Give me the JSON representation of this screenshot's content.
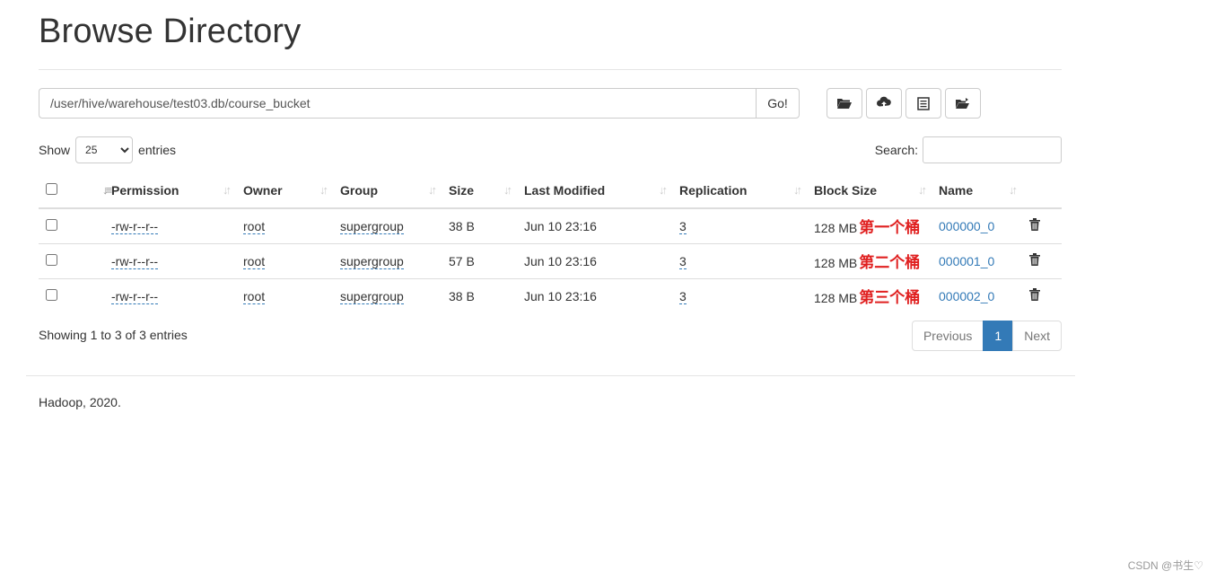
{
  "page": {
    "title": "Browse Directory"
  },
  "path": {
    "value": "/user/hive/warehouse/test03.db/course_bucket",
    "go_label": "Go!"
  },
  "toolbar": {
    "icons": [
      "folder-open-icon",
      "upload-icon",
      "list-icon",
      "move-folder-icon"
    ]
  },
  "show": {
    "prefix": "Show",
    "selected": "25",
    "suffix": "entries"
  },
  "search": {
    "label": "Search:",
    "value": ""
  },
  "table": {
    "headers": {
      "permission": "Permission",
      "owner": "Owner",
      "group": "Group",
      "size": "Size",
      "last_modified": "Last Modified",
      "replication": "Replication",
      "block_size": "Block Size",
      "name": "Name"
    },
    "rows": [
      {
        "permission": "-rw-r--r--",
        "owner": "root",
        "group": "supergroup",
        "size": "38 B",
        "last_modified": "Jun 10 23:16",
        "replication": "3",
        "block_size": "128 MB",
        "annotation": "第一个桶",
        "name": "000000_0"
      },
      {
        "permission": "-rw-r--r--",
        "owner": "root",
        "group": "supergroup",
        "size": "57 B",
        "last_modified": "Jun 10 23:16",
        "replication": "3",
        "block_size": "128 MB",
        "annotation": "第二个桶",
        "name": "000001_0"
      },
      {
        "permission": "-rw-r--r--",
        "owner": "root",
        "group": "supergroup",
        "size": "38 B",
        "last_modified": "Jun 10 23:16",
        "replication": "3",
        "block_size": "128 MB",
        "annotation": "第三个桶",
        "name": "000002_0"
      }
    ]
  },
  "info": "Showing 1 to 3 of 3 entries",
  "pager": {
    "previous": "Previous",
    "current": "1",
    "next": "Next"
  },
  "footer": "Hadoop, 2020.",
  "watermark": "CSDN @书生♡",
  "colors": {
    "link": "#337ab7",
    "annotation": "#e02020",
    "active_page": "#337ab7"
  }
}
